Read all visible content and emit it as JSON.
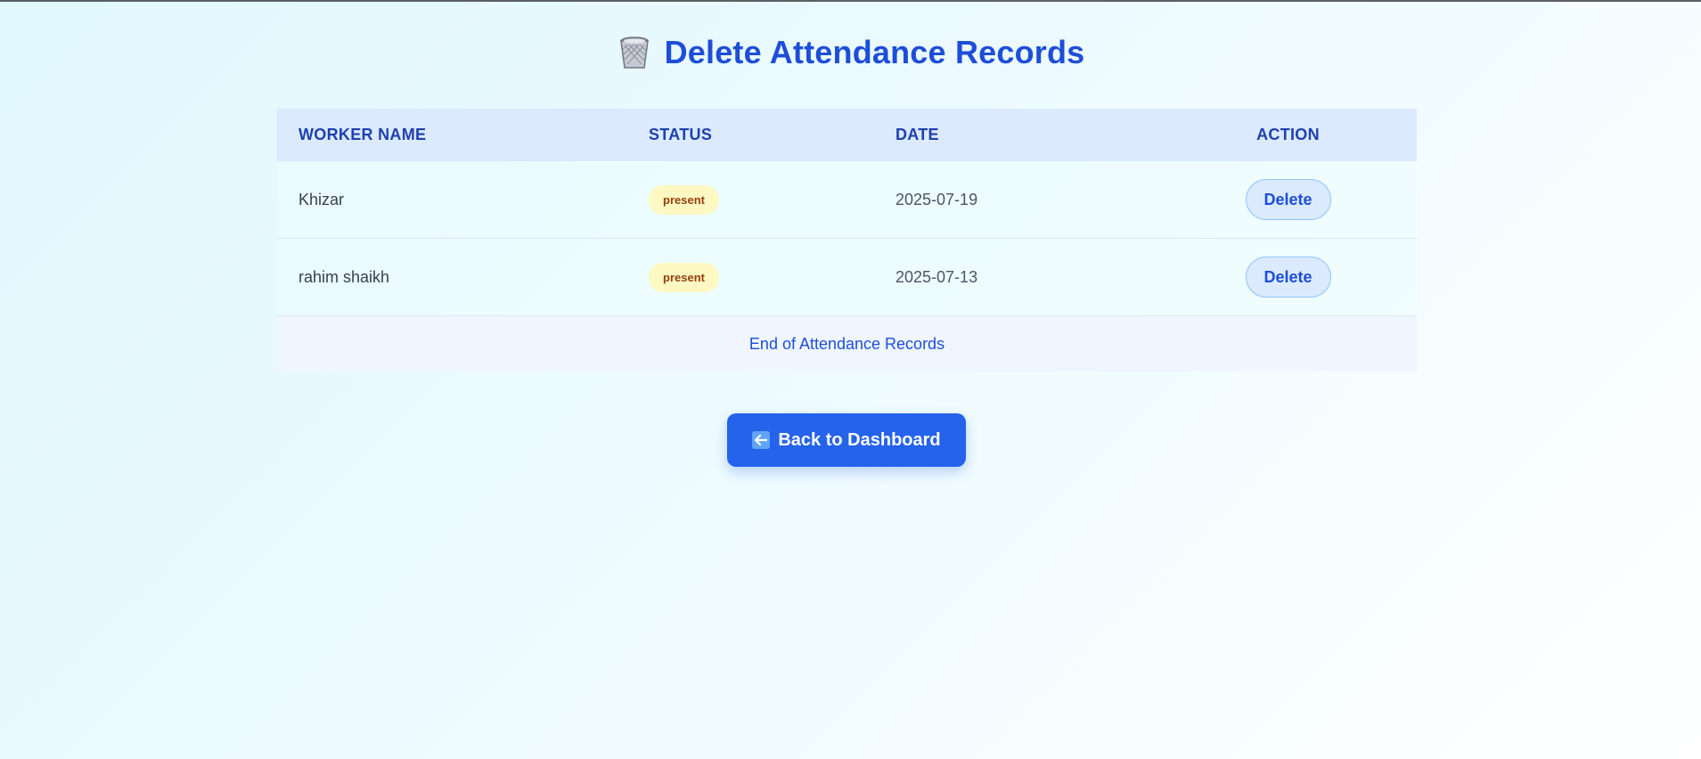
{
  "header": {
    "title": "Delete Attendance Records",
    "icon": "wastebasket-icon"
  },
  "table": {
    "columns": [
      "WORKER NAME",
      "STATUS",
      "DATE",
      "ACTION"
    ],
    "rows": [
      {
        "worker_name": "Khizar",
        "status": "present",
        "date": "2025-07-19",
        "action_label": "Delete"
      },
      {
        "worker_name": "rahim shaikh",
        "status": "present",
        "date": "2025-07-13",
        "action_label": "Delete"
      }
    ],
    "footer": "End of Attendance Records"
  },
  "back_button": {
    "label": "Back to Dashboard",
    "icon": "left-arrow-icon"
  },
  "colors": {
    "accent": "#2563eb",
    "title": "#1d4ed8",
    "header_bg": "#dbeafe",
    "badge_bg": "#fef9c3",
    "badge_text": "#92400e"
  }
}
